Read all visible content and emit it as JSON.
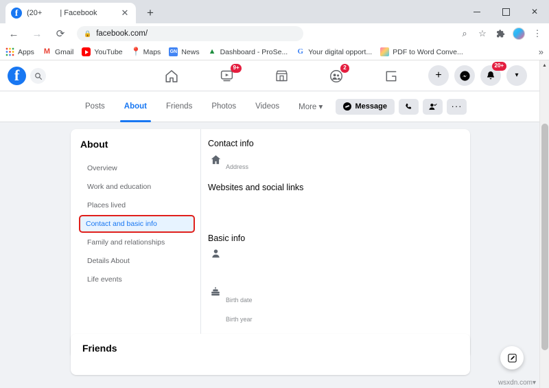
{
  "browser": {
    "tab": {
      "title_left": "(20+",
      "title_right": "| Facebook",
      "close_icon": "close-icon",
      "favicon": "facebook-favicon"
    },
    "new_tab_label": "+",
    "window_controls": {
      "minimize": "",
      "maximize": "",
      "close": "✕"
    },
    "nav": {
      "back": "←",
      "forward": "→",
      "reload": "⟳"
    },
    "omnibox": {
      "lock_icon": "lock-icon",
      "url": "facebook.com/"
    },
    "toolbar_icons": [
      {
        "name": "zoom-search-icon",
        "glyph": "⌕"
      },
      {
        "name": "bookmark-star-icon",
        "glyph": "☆"
      },
      {
        "name": "extensions-puzzle-icon",
        "glyph": "🧩"
      },
      {
        "name": "profile-avatar-icon",
        "glyph": ""
      },
      {
        "name": "chrome-menu-icon",
        "glyph": "⋮"
      }
    ],
    "bookmarks": [
      {
        "label": "Apps",
        "icon": "apps-grid-icon"
      },
      {
        "label": "Gmail",
        "icon": "gmail-icon"
      },
      {
        "label": "YouTube",
        "icon": "youtube-icon"
      },
      {
        "label": "Maps",
        "icon": "maps-pin-icon"
      },
      {
        "label": "News",
        "icon": "google-news-icon"
      },
      {
        "label": "Dashboard - ProSe...",
        "icon": "dashboard-icon"
      },
      {
        "label": "Your digital opport...",
        "icon": "google-g-icon"
      },
      {
        "label": "PDF to Word Conve...",
        "icon": "pdf-converter-icon"
      }
    ],
    "bookmarks_overflow": "»"
  },
  "fbheader": {
    "logo": "f",
    "search_icon": "search-icon",
    "nav": [
      {
        "name": "home-icon",
        "badge": ""
      },
      {
        "name": "watch-video-icon",
        "badge": "9+"
      },
      {
        "name": "marketplace-icon",
        "badge": ""
      },
      {
        "name": "groups-icon",
        "badge": "2"
      },
      {
        "name": "gaming-icon",
        "badge": ""
      }
    ],
    "right": [
      {
        "name": "create-plus-icon",
        "glyph": "+",
        "badge": ""
      },
      {
        "name": "messenger-icon",
        "glyph": "",
        "badge": ""
      },
      {
        "name": "notifications-bell-icon",
        "glyph": "",
        "badge": "20+"
      },
      {
        "name": "account-dropdown-icon",
        "glyph": "▾",
        "badge": ""
      }
    ]
  },
  "profile_nav": {
    "tabs": [
      {
        "label": "Posts",
        "active": false
      },
      {
        "label": "About",
        "active": true
      },
      {
        "label": "Friends",
        "active": false
      },
      {
        "label": "Photos",
        "active": false
      },
      {
        "label": "Videos",
        "active": false
      },
      {
        "label": "More ▾",
        "active": false
      }
    ],
    "actions": {
      "message_label": "Message",
      "call_icon": "phone-icon",
      "add_friend_icon": "add-friend-icon",
      "more_icon": "more-options-icon"
    }
  },
  "about": {
    "heading": "About",
    "sidebar_items": [
      {
        "label": "Overview",
        "selected": false
      },
      {
        "label": "Work and education",
        "selected": false
      },
      {
        "label": "Places lived",
        "selected": false
      },
      {
        "label": "Contact and basic info",
        "selected": true
      },
      {
        "label": "Family and relationships",
        "selected": false
      },
      {
        "label": "Details About",
        "selected": false
      },
      {
        "label": "Life events",
        "selected": false
      }
    ],
    "sections": {
      "contact_info_title": "Contact info",
      "address_icon": "home-icon",
      "address_label": "Address",
      "websites_title": "Websites and social links",
      "basic_info_title": "Basic info",
      "gender_icon": "person-icon",
      "birth_icon": "birthday-cake-icon",
      "birth_date_label": "Birth date",
      "birth_year_label": "Birth year"
    }
  },
  "friends_card": {
    "title": "Friends"
  },
  "fab": {
    "icon": "edit-pencil-icon"
  },
  "watermark": "wsxdn.com",
  "colors": {
    "fb_blue": "#1877f2",
    "highlight_bg": "#e7f3ff",
    "highlight_border": "#e0201b",
    "badge_red": "#e41e3f",
    "page_bg": "#f0f2f5"
  }
}
